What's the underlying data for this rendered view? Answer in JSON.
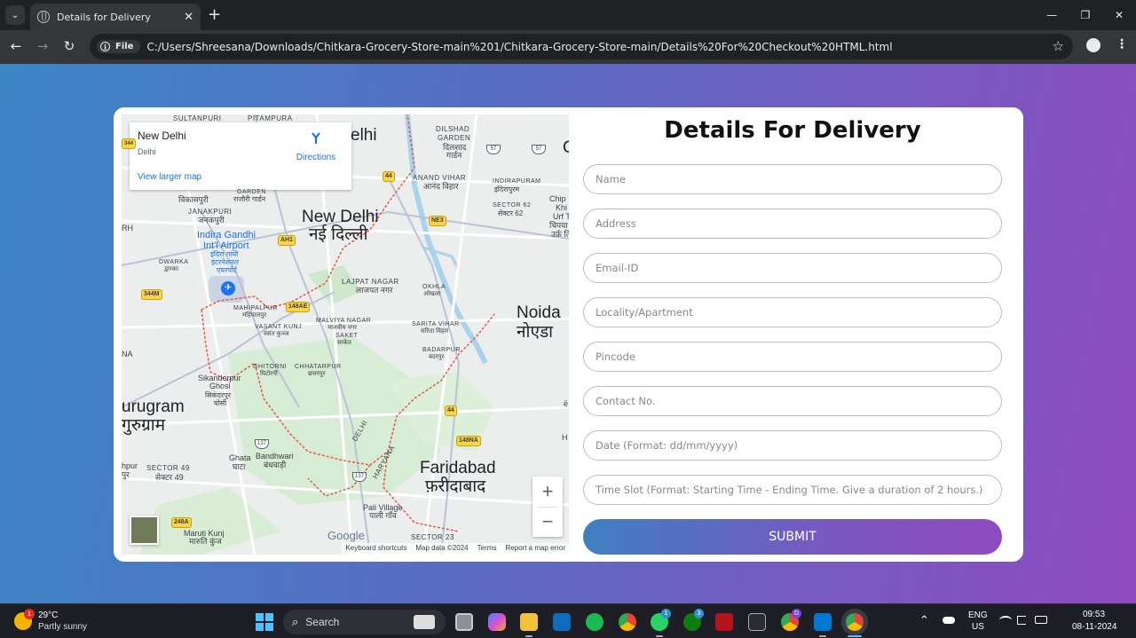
{
  "browser": {
    "tab_title": "Details for Delivery",
    "tab_close": "✕",
    "new_tab": "+",
    "menu_chevron": "⌄",
    "window_controls": [
      "—",
      "❐",
      "✕"
    ],
    "nav": {
      "back": "←",
      "forward": "→",
      "reload": "↻"
    },
    "chip_label": "File",
    "chip_icon": "i",
    "url": "C:/Users/Shreesana/Downloads/Chitkara-Grocery-Store-main%201/Chitkara-Grocery-Store-main/Details%20For%20Checkout%20HTML.html",
    "bookmark_icon": "☆",
    "menu_icon": "⋮"
  },
  "map": {
    "place_name": "New Delhi",
    "place_sub": "Delhi",
    "view_larger": "View larger map",
    "directions": "Directions",
    "labels": {
      "sultanpuri": "SULTANPURI",
      "pitampura": "PITAMPURA",
      "delhi": "elhi",
      "dilshad": "DILSHAD",
      "garden": "GARDEN",
      "dilshad_hi": "दिलशाद",
      "garden_hi": "गार्डन",
      "anand_vihar": "ANAND VIHAR",
      "anand_vihar_hi": "आनंद विहार",
      "indirapuram": "INDIRAPURAM",
      "indirapuram_hi": "इंदिरापुरम",
      "sector62": "SECTOR 62",
      "sector62_hi": "सेक्टर 62",
      "vikaspuri": "विकासपुरी",
      "rajouri": "GARDEN",
      "rajouri_hi": "राजौरी गार्डन",
      "janakpuri": "JANAKPURI",
      "janakpuri_hi": "जनकपुरी",
      "new_delhi": "New Delhi",
      "new_delhi_hi": "नई दिल्ली",
      "airport": "Indira Gandhi",
      "airport2": "Int'l Airport",
      "airport_hi": "इंदिरा गांधी",
      "airport_hi2": "इंटरनेशनल",
      "airport_hi3": "एयरपोर्ट",
      "dwarka": "DWARKA",
      "dwarka_hi": "द्वारका",
      "lajpat": "LAJPAT NAGAR",
      "lajpat_hi": "लाजपत नगर",
      "okhla": "OKHLA",
      "okhla_hi": "ओखला",
      "noida": "Noida",
      "noida_hi": "नोएडा",
      "mahipalpur": "MAHIPALPUR",
      "mahipalpur_hi": "महिपालपुर",
      "malviya": "MALVIYA NAGAR",
      "malviya_hi": "मालवीय नगर",
      "vasant_kunj": "VASANT KUNJ",
      "vasant_kunj_hi": "वसंत कुञ्ज",
      "saket": "SAKET",
      "saket_hi": "साकेत",
      "sarita": "SARITA VIHAR",
      "sarita_hi": "सरिता विहार",
      "badarpur": "BADARPUR",
      "badarpur_hi": "बदरपुर",
      "ghitorni": "GHITORNI",
      "ghitorni_hi": "घिटोरनी",
      "chhatarpur": "CHHATARPUR",
      "chhatarpur_hi": "छत्तरपुर",
      "sikanderpur": "Sikanderpur",
      "ghosi": "Ghosi",
      "sikanderpur_hi": "सिकंदरपुर",
      "ghosi_hi": "घोसी",
      "gurugram": "urugram",
      "gurugram_hi": "गुरुग्राम",
      "faridabad": "Faridabad",
      "faridabad_hi": "फ़रीदाबाद",
      "delhi_state": "DELHI",
      "haryana": "HARYANA",
      "sector49": "SECTOR 49",
      "sector49_hi": "सेक्टर 49",
      "ghata": "Ghata",
      "ghata_hi": "घाटा",
      "bandhwari": "Bandhwari",
      "bandhwari_hi": "बंधवाड़ी",
      "pali": "Pali Village",
      "pali_hi": "पाली गाँव",
      "maruti": "Maruti Kunj",
      "maruti_hi": "मारुति कुंज",
      "sector23": "SECTOR 23",
      "rh": "RH",
      "na": "NA",
      "hpur": "hpur",
      "pur": "पुर",
      "chip": "Chip",
      "khi": "Khi",
      "urf": "Urf T",
      "chip_hi": "चिपया",
      "urf_hi": "उर्फ़ ति",
      "o_edge": "C",
      "h_edge": "H",
      "e_edge": "ē"
    },
    "shields": {
      "s44a": "44",
      "s44b": "44",
      "ah1": "AH1",
      "ne3": "NE3",
      "s344m": "344M",
      "s148ae": "148AE",
      "s148na": "148NA",
      "s248a": "248A",
      "s57a": "57",
      "s57b": "57",
      "s137a": "137",
      "s137b": "137",
      "s344": "344"
    },
    "zoom_in": "+",
    "zoom_out": "−",
    "google": "Google",
    "attribution": [
      "Keyboard shortcuts",
      "Map data ©2024",
      "Terms",
      "Report a map error"
    ]
  },
  "form": {
    "title": "Details For Delivery",
    "fields": [
      {
        "placeholder": "Name"
      },
      {
        "placeholder": "Address"
      },
      {
        "placeholder": "Email-ID"
      },
      {
        "placeholder": "Locality/Apartment"
      },
      {
        "placeholder": "Pincode"
      },
      {
        "placeholder": "Contact No."
      },
      {
        "placeholder": "Date (Format: dd/mm/yyyy)"
      },
      {
        "placeholder": "Time Slot (Format: Starting Time - Ending Time. Give a duration of 2 hours.)"
      }
    ],
    "submit": "SUBMIT"
  },
  "taskbar": {
    "temperature": "29°C",
    "condition": "Partly sunny",
    "weather_badge": "1",
    "search": "Search",
    "search_icon": "⌕",
    "whatsapp_badge": "1",
    "xbox_badge": "3",
    "chrome_badge": "D",
    "lang": "ENG",
    "region": "US",
    "time": "09:53",
    "date": "08-11-2024",
    "tray_chevron": "⌃"
  }
}
